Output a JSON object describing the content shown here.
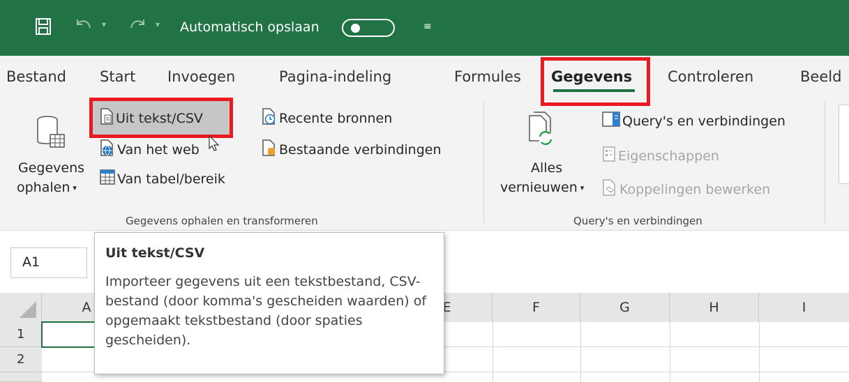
{
  "title_bar": {
    "autosave_label": "Automatisch opslaan",
    "autosave_state": "off",
    "qat_more": "≡"
  },
  "tabs": [
    "Bestand",
    "Start",
    "Invoegen",
    "Pagina-indeling",
    "Formules",
    "Gegevens",
    "Controleren",
    "Beeld"
  ],
  "active_tab": "Gegevens",
  "ribbon": {
    "get_data": {
      "line1": "Gegevens",
      "line2": "ophalen"
    },
    "from_text_csv": "Uit tekst/CSV",
    "from_web": "Van het web",
    "from_table": "Van tabel/bereik",
    "recent_sources": "Recente bronnen",
    "existing_connections": "Bestaande verbindingen",
    "group1_label": "Gegevens ophalen en transformeren",
    "refresh_all": {
      "line1": "Alles",
      "line2": "vernieuwen"
    },
    "queries_connections": "Query's en verbindingen",
    "properties": "Eigenschappen",
    "edit_links": "Koppelingen bewerken",
    "group2_label": "Query's en verbindingen"
  },
  "name_box": "A1",
  "columns": [
    "A",
    "E",
    "F",
    "G",
    "H",
    "I"
  ],
  "rows": [
    "1",
    "2"
  ],
  "tooltip": {
    "title": "Uit tekst/CSV",
    "body": "Importeer gegevens uit een tekstbestand, CSV-bestand (door komma's gescheiden waarden) of opgemaakt tekstbestand (door spaties gescheiden)."
  },
  "colors": {
    "excel_green": "#217346",
    "highlight_red": "#e81b23"
  }
}
